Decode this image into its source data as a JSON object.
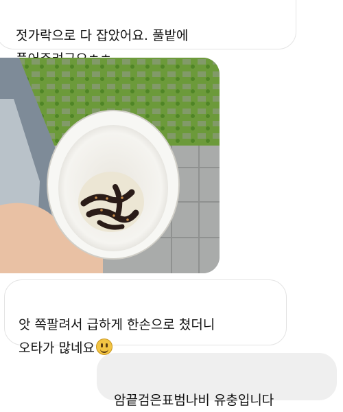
{
  "messages": {
    "top": "젓가락으로 다 잡았어요. 풀밭에\n풀어주려구요ㅎㅎ",
    "typo_text": "앗 쪽팔려서 급하게 한손으로 쳤더니\n오타가 많네요",
    "species": "암끝검은표범나비 유충입니다"
  },
  "photo": {
    "subject": "cup-with-caterpillars"
  },
  "icons": {
    "emoji": "smiling-face-emoji"
  },
  "colors": {
    "incoming_bubble": "#ffffff",
    "incoming_border": "#e3e3e3",
    "outgoing_bubble": "#efefef",
    "grass": "#6f9a3a",
    "cup": "#f7f7f4"
  }
}
